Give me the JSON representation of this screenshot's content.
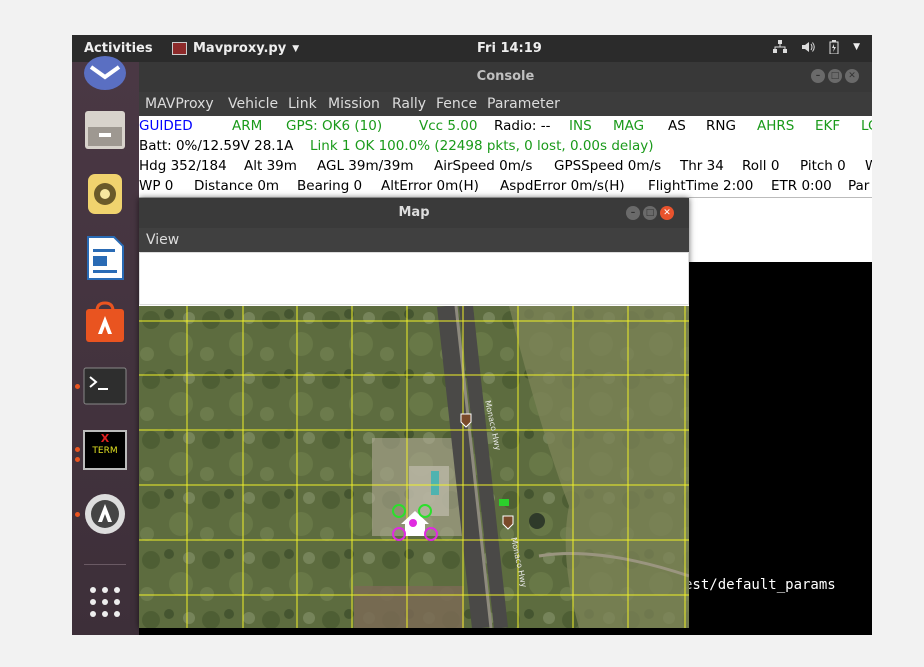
{
  "topbar": {
    "activities": "Activities",
    "app_menu": "Mavproxy.py",
    "clock": "Fri 14:19",
    "tray_icons": [
      "network-icon",
      "volume-icon",
      "battery-icon",
      "system-menu-caret-icon"
    ]
  },
  "dock": {
    "items": [
      "thunderbird-icon",
      "files-icon",
      "rhythmbox-icon",
      "writer-icon",
      "software-center-icon",
      "terminal-icon",
      "xterm-icon",
      "software-updater-icon",
      "show-apps-icon"
    ],
    "xterm_label_1": "X",
    "xterm_label_2": "TERM"
  },
  "console": {
    "title": "Console",
    "menu": [
      "MAVProxy",
      "Vehicle",
      "Link",
      "Mission",
      "Rally",
      "Fence",
      "Parameter"
    ],
    "row1": {
      "mode": "GUIDED",
      "arm": "ARM",
      "gps": "GPS: OK6 (10)",
      "vcc": "Vcc 5.00",
      "radio": "Radio: --",
      "ins": "INS",
      "mag": "MAG",
      "as": "AS",
      "rng": "RNG",
      "ahrs": "AHRS",
      "ekf": "EKF",
      "lo": "LO"
    },
    "row2": {
      "batt": "Batt: 0%/12.59V 28.1A",
      "link": "Link 1 OK 100.0% (22498 pkts, 0 lost, 0.00s delay)"
    },
    "row3": {
      "hdg": "Hdg 352/184",
      "alt": "Alt 39m",
      "agl": "AGL 39m/39m",
      "airspeed": "AirSpeed 0m/s",
      "gpsspeed": "GPSSpeed 0m/s",
      "thr": "Thr 34",
      "roll": "Roll 0",
      "pitch": "Pitch 0",
      "w": "W"
    },
    "row4": {
      "wp": "WP 0",
      "distance": "Distance 0m",
      "bearing": "Bearing 0",
      "alterror": "AltError 0m(H)",
      "aspderror": "AspdError 0m/s(H)",
      "flighttime": "FlightTime 2:00",
      "etr": "ETR 0:00",
      "par": "Par"
    },
    "terminal_text": "est/default_params",
    "colors": {
      "guided": "#0000ff",
      "ok_green": "#1a9a1a",
      "black": "#000000"
    }
  },
  "map": {
    "title": "Map",
    "menu": [
      "View"
    ],
    "road_label_1": "Monaco Hwy",
    "road_label_2": "Monaco Hwy"
  }
}
